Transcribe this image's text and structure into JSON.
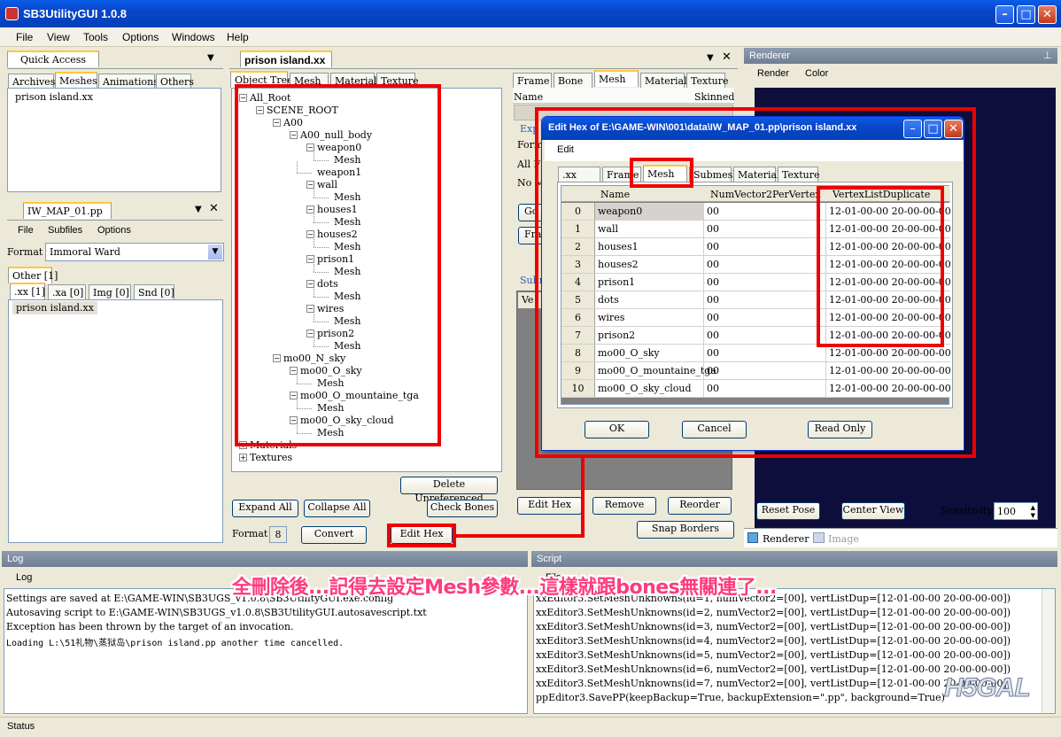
{
  "window": {
    "title": "SB3UtilityGUI 1.0.8"
  },
  "menu": [
    "File",
    "View",
    "Tools",
    "Options",
    "Windows",
    "Help"
  ],
  "quick_access": {
    "title": "Quick Access",
    "tabs": [
      "Archives",
      "Meshes",
      "Animations",
      "Others"
    ],
    "items": [
      "prison island.xx"
    ]
  },
  "pp_panel": {
    "title": "IW_MAP_01.pp",
    "menu": [
      "File",
      "Subfiles",
      "Options"
    ],
    "format_label": "Format",
    "format_value": "Immoral Ward",
    "outer_tab": "Other [1]",
    "tabs": [
      ".xx [1]",
      ".xa [0]",
      "Img [0]",
      "Snd [0]"
    ],
    "items": [
      "prison island.xx"
    ]
  },
  "doc": {
    "title": "prison island.xx",
    "tabs": [
      "Object Tree",
      "Mesh",
      "Material",
      "Texture"
    ],
    "tree": [
      "All_Root",
      "SCENE_ROOT",
      "A00",
      "A00_null_body",
      "weapon0",
      "Mesh",
      "weapon1",
      "wall",
      "Mesh",
      "houses1",
      "Mesh",
      "houses2",
      "Mesh",
      "prison1",
      "Mesh",
      "dots",
      "Mesh",
      "wires",
      "Mesh",
      "prison2",
      "Mesh",
      "mo00_N_sky",
      "mo00_O_sky",
      "Mesh",
      "mo00_O_mountaine_tga",
      "Mesh",
      "mo00_O_sky_cloud",
      "Mesh",
      "Materials",
      "Textures"
    ],
    "buttons": {
      "delete_unreferenced": "Delete Unreferenced",
      "expand_all": "Expand All",
      "collapse_all": "Collapse All",
      "check_bones": "Check Bones",
      "format_label": "Format",
      "format_value": "8",
      "convert": "Convert",
      "edit_hex": "Edit Hex"
    },
    "right_tabs": [
      "Frame",
      "Bone",
      "Mesh",
      "Material",
      "Texture"
    ],
    "right_cols": {
      "name": "Name",
      "skinned": "Skinned"
    },
    "partial": [
      "Exp",
      "Form",
      "All F",
      "No M",
      "Go",
      "Fra",
      "Subm",
      "Ve"
    ],
    "right_buttons": {
      "edit_hex": "Edit Hex",
      "remove": "Remove",
      "reorder": "Reorder",
      "snap_borders": "Snap Borders"
    }
  },
  "renderer": {
    "title": "Renderer",
    "menu": [
      "Render",
      "Color"
    ],
    "reset_pose": "Reset Pose",
    "center_view": "Center View",
    "sensitivity_label": "Sensitivity",
    "sensitivity_value": "100",
    "tabs": [
      "Renderer",
      "Image"
    ],
    "viewport_color": "#0e0e3c"
  },
  "dialog": {
    "title": "Edit Hex of E:\\GAME-WIN\\001\\data\\IW_MAP_01.pp\\prison island.xx",
    "menu": [
      "Edit"
    ],
    "tabs": [
      ".xx",
      "Frame",
      "Mesh",
      "Submesh",
      "Material",
      "Texture"
    ],
    "columns": [
      "Name",
      "NumVector2PerVertex",
      "VertexListDuplicate"
    ],
    "rows": [
      {
        "idx": "0",
        "name": "weapon0",
        "nv": "00",
        "vld": "12-01-00-00 20-00-00-00"
      },
      {
        "idx": "1",
        "name": "wall",
        "nv": "00",
        "vld": "12-01-00-00 20-00-00-00"
      },
      {
        "idx": "2",
        "name": "houses1",
        "nv": "00",
        "vld": "12-01-00-00 20-00-00-00"
      },
      {
        "idx": "3",
        "name": "houses2",
        "nv": "00",
        "vld": "12-01-00-00 20-00-00-00"
      },
      {
        "idx": "4",
        "name": "prison1",
        "nv": "00",
        "vld": "12-01-00-00 20-00-00-00"
      },
      {
        "idx": "5",
        "name": "dots",
        "nv": "00",
        "vld": "12-01-00-00 20-00-00-00"
      },
      {
        "idx": "6",
        "name": "wires",
        "nv": "00",
        "vld": "12-01-00-00 20-00-00-00"
      },
      {
        "idx": "7",
        "name": "prison2",
        "nv": "00",
        "vld": "12-01-00-00 20-00-00-00"
      },
      {
        "idx": "8",
        "name": "mo00_O_sky",
        "nv": "00",
        "vld": "12-01-00-00 20-00-00-00"
      },
      {
        "idx": "9",
        "name": "mo00_O_mountaine_tga",
        "nv": "00",
        "vld": "12-01-00-00 20-00-00-00"
      },
      {
        "idx": "10",
        "name": "mo00_O_sky_cloud",
        "nv": "00",
        "vld": "12-01-00-00 20-00-00-00"
      }
    ],
    "ok": "OK",
    "cancel": "Cancel",
    "read_only": "Read Only"
  },
  "log": {
    "title": "Log",
    "menu": "Log",
    "lines": [
      "Settings are saved at E:\\GAME-WIN\\SB3UGS_v1.0.8\\SB3UtilityGUI.exe.config",
      "Autosaving script to E:\\GAME-WIN\\SB3UGS_v1.0.8\\SB3UtilityGUI.autosavescript.txt",
      "Exception has been thrown by the target of an invocation.",
      "Loading L:\\51礼物\\蒸狱岛\\prison island.pp another time cancelled."
    ]
  },
  "script": {
    "title": "Script",
    "menu": "File",
    "lines": [
      "xxEditor3.SetMeshUnknowns(id=1, numVector2=[00], vertListDup=[12-01-00-00 20-00-00-00])",
      "xxEditor3.SetMeshUnknowns(id=2, numVector2=[00], vertListDup=[12-01-00-00 20-00-00-00])",
      "xxEditor3.SetMeshUnknowns(id=3, numVector2=[00], vertListDup=[12-01-00-00 20-00-00-00])",
      "xxEditor3.SetMeshUnknowns(id=4, numVector2=[00], vertListDup=[12-01-00-00 20-00-00-00])",
      "xxEditor3.SetMeshUnknowns(id=5, numVector2=[00], vertListDup=[12-01-00-00 20-00-00-00])",
      "xxEditor3.SetMeshUnknowns(id=6, numVector2=[00], vertListDup=[12-01-00-00 20-00-00-00])",
      "xxEditor3.SetMeshUnknowns(id=7, numVector2=[00], vertListDup=[12-01-00-00 20-00-00-00])",
      "ppEditor3.SavePP(keepBackup=True, backupExtension=\".pp\", background=True)"
    ]
  },
  "caption": "全刪除後...記得去設定Mesh參數...這樣就跟bones無關連了...",
  "status": "Status",
  "watermark": "H5GAL",
  "colors": {
    "annotation": "#e00000",
    "titlebar": "#0b45c8",
    "caption_fill": "#ff3b7d"
  }
}
